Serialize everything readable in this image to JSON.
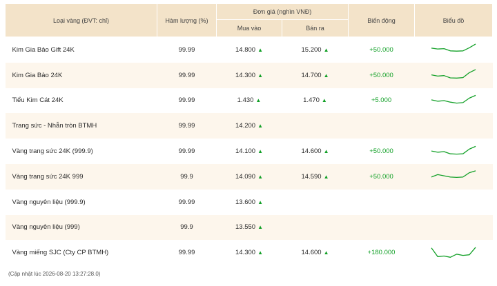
{
  "header": {
    "type": "Loại vàng (ĐVT: chỉ)",
    "purity": "Hàm lượng (%)",
    "unit_price": "Đơn giá (nghìn VNĐ)",
    "buy": "Mua vào",
    "sell": "Bán ra",
    "change": "Biến động",
    "chart": "Biểu đồ"
  },
  "rows": [
    {
      "name": "Kim Gia Bảo Gift 24K",
      "purity": "99.99",
      "buy": "14.800",
      "sell": "15.200",
      "change": "+50.000",
      "spark": [
        0.62,
        0.55,
        0.58,
        0.4,
        0.38,
        0.4,
        0.65,
        0.95
      ]
    },
    {
      "name": "Kim Gia Bảo 24K",
      "purity": "99.99",
      "buy": "14.300",
      "sell": "14.700",
      "change": "+50.000",
      "spark": [
        0.52,
        0.42,
        0.46,
        0.28,
        0.26,
        0.3,
        0.7,
        0.95
      ]
    },
    {
      "name": "Tiểu Kim Cát 24K",
      "purity": "99.99",
      "buy": "1.430",
      "sell": "1.470",
      "change": "+5.000",
      "spark": [
        0.56,
        0.45,
        0.5,
        0.38,
        0.3,
        0.34,
        0.7,
        0.92
      ]
    },
    {
      "name": "Trang sức - Nhẫn tròn BTMH",
      "purity": "99.99",
      "buy": "14.200",
      "sell": "",
      "change": "",
      "spark": null
    },
    {
      "name": "Vàng trang sức 24K (999.9)",
      "purity": "99.99",
      "buy": "14.100",
      "sell": "14.600",
      "change": "+50.000",
      "spark": [
        0.55,
        0.45,
        0.5,
        0.32,
        0.3,
        0.32,
        0.7,
        0.92
      ]
    },
    {
      "name": "Vàng trang sức 24K 999",
      "purity": "99.9",
      "buy": "14.090",
      "sell": "14.590",
      "change": "+50.000",
      "spark": [
        0.45,
        0.65,
        0.55,
        0.45,
        0.42,
        0.45,
        0.8,
        0.95
      ]
    },
    {
      "name": "Vàng nguyên liệu (999.9)",
      "purity": "99.99",
      "buy": "13.600",
      "sell": "",
      "change": "",
      "spark": null
    },
    {
      "name": "Vàng nguyên liệu (999)",
      "purity": "99.9",
      "buy": "13.550",
      "sell": "",
      "change": "",
      "spark": null
    },
    {
      "name": "Vàng miếng SJC (Cty CP BTMH)",
      "purity": "99.99",
      "buy": "14.300",
      "sell": "14.600",
      "change": "+180.000",
      "spark": [
        0.9,
        0.2,
        0.25,
        0.15,
        0.4,
        0.3,
        0.35,
        0.95
      ]
    }
  ],
  "footer": "(Cập nhật lúc 2026-08-20 13:27:28.0)",
  "colors": {
    "header_bg": "#f3e3c9",
    "alt_row": "#fdf6ec",
    "up": "#12a027"
  },
  "icons": {
    "up": "triangle-up-icon"
  }
}
